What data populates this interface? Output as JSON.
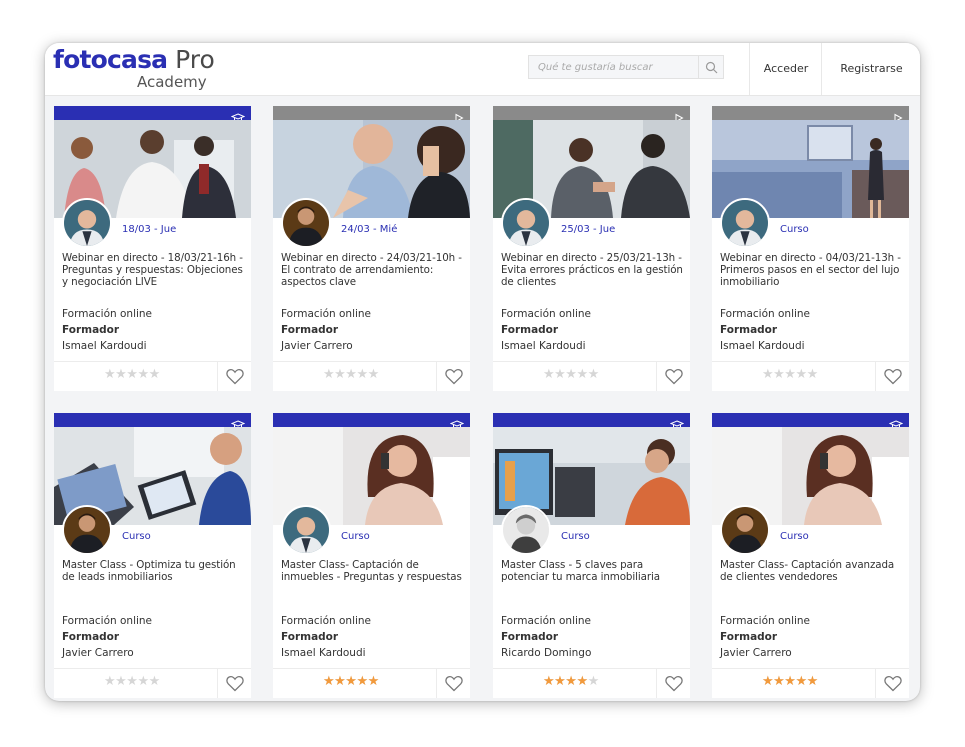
{
  "header": {
    "logo_brand": "fotocasa",
    "logo_suffix": "Pro",
    "logo_sub": "Academy",
    "search_placeholder": "Qué te gustaría buscar",
    "login_label": "Acceder",
    "register_label": "Registrarse"
  },
  "colors": {
    "brand_blue": "#2a2fb3",
    "star_active": "#f29a3c",
    "star_inactive": "#d6d6d6"
  },
  "cards": [
    {
      "badge_icon": "graduation-cap-icon",
      "tag": "18/03 - Jue",
      "title": "Webinar en directo - 18/03/21-16h - Preguntas y respuestas: Objeciones y negociación LIVE",
      "mode": "Formación online",
      "trainer_label": "Formador",
      "trainer": "Ismael Kardoudi",
      "rating": 0
    },
    {
      "badge_icon": "play-icon",
      "tag": "24/03 - Mié",
      "title": "Webinar en directo - 24/03/21-10h - El contrato de arrendamiento: aspectos clave",
      "mode": "Formación online",
      "trainer_label": "Formador",
      "trainer": "Javier Carrero",
      "rating": 0
    },
    {
      "badge_icon": "play-icon",
      "tag": "25/03 - Jue",
      "title": "Webinar en directo - 25/03/21-13h - Evita errores prácticos en la gestión de clientes",
      "mode": "Formación online",
      "trainer_label": "Formador",
      "trainer": "Ismael Kardoudi",
      "rating": 0
    },
    {
      "badge_icon": "play-icon",
      "tag": "Curso",
      "title": "Webinar en directo - 04/03/21-13h - Primeros pasos en el sector del lujo inmobiliario",
      "mode": "Formación online",
      "trainer_label": "Formador",
      "trainer": "Ismael Kardoudi",
      "rating": 0
    },
    {
      "badge_icon": "graduation-cap-icon",
      "tag": "Curso",
      "title": "Master Class - Optimiza tu gestión de leads inmobiliarios",
      "mode": "Formación online",
      "trainer_label": "Formador",
      "trainer": "Javier Carrero",
      "rating": 0
    },
    {
      "badge_icon": "graduation-cap-icon",
      "tag": "Curso",
      "title": "Master Class- Captación de inmuebles - Preguntas y respuestas",
      "mode": "Formación online",
      "trainer_label": "Formador",
      "trainer": "Ismael Kardoudi",
      "rating": 5
    },
    {
      "badge_icon": "graduation-cap-icon",
      "tag": "Curso",
      "title": "Master Class - 5 claves para potenciar tu marca inmobiliaria",
      "mode": "Formación online",
      "trainer_label": "Formador",
      "trainer": "Ricardo Domingo",
      "rating": 3.5
    },
    {
      "badge_icon": "graduation-cap-icon",
      "tag": "Curso",
      "title": "Master Class- Captación avanzada de clientes vendedores",
      "mode": "Formación online",
      "trainer_label": "Formador",
      "trainer": "Javier Carrero",
      "rating": 5
    }
  ]
}
